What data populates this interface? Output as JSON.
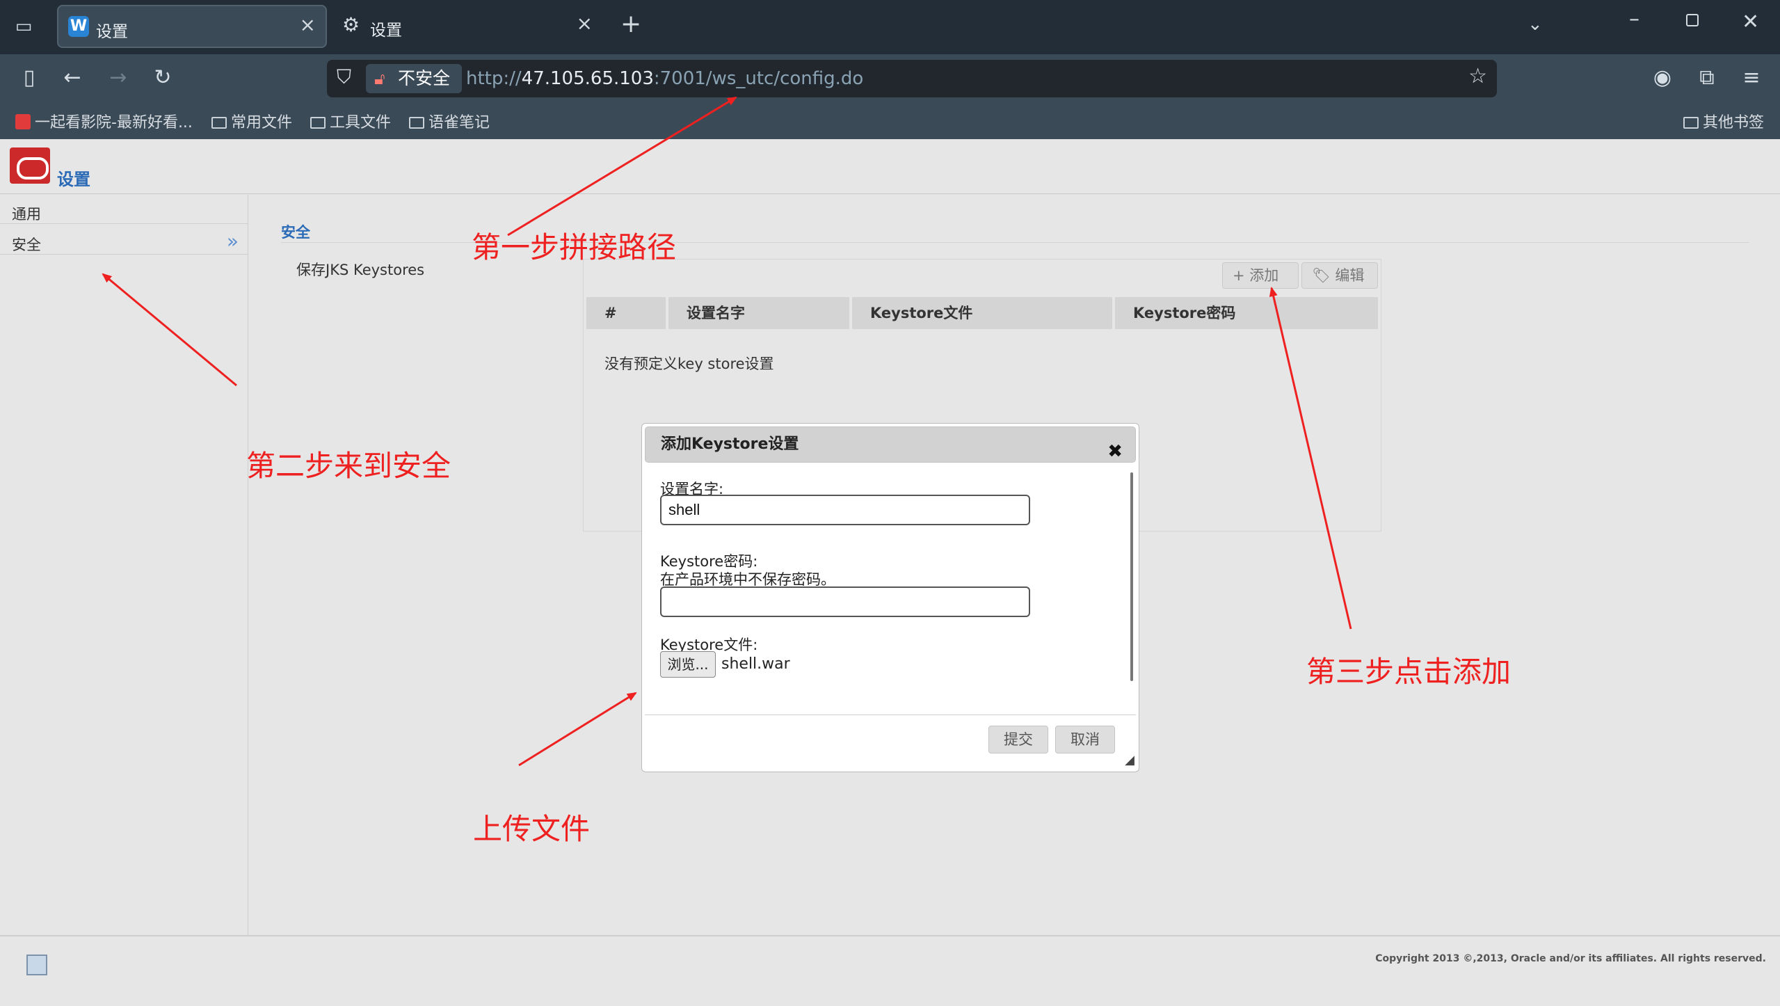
{
  "browser": {
    "tabs": [
      {
        "title": "设置",
        "close": "×"
      },
      {
        "title": "设置",
        "close": "×"
      }
    ],
    "new_tab": "+",
    "insecure_label": "不安全",
    "url_prefix": "http://",
    "url_host": "47.105.65.103",
    "url_rest": ":7001/ws_utc/config.do",
    "bookmarks": [
      "一起看影院-最新好看...",
      "常用文件",
      "工具文件",
      "语雀笔记"
    ],
    "other_bookmarks": "其他书签"
  },
  "header": {
    "title": "设置"
  },
  "sidebar": {
    "items": [
      {
        "label": "通用"
      },
      {
        "label": "安全",
        "arrow": "»"
      }
    ]
  },
  "main": {
    "section_title": "安全",
    "sub_label": "保存JKS Keystores",
    "toolbar": {
      "add": "添加",
      "edit": "编辑"
    },
    "table": {
      "columns": [
        "#",
        "设置名字",
        "Keystore文件",
        "Keystore密码"
      ],
      "empty_text": "没有预定义key store设置"
    }
  },
  "dialog": {
    "title": "添加Keystore设置",
    "close": "✖",
    "name_label": "设置名字:",
    "name_value": "shell",
    "password_label": "Keystore密码:",
    "password_hint": "在产品环境中不保存密码。",
    "password_value": "",
    "file_label": "Keystore文件:",
    "browse_label": "浏览...",
    "file_name": "shell.war",
    "submit": "提交",
    "cancel": "取消"
  },
  "footer": {
    "copyright": "Copyright 2013 ©,2013, Oracle and/or its affiliates. All rights reserved."
  },
  "annotations": {
    "step1": "第一步拼接路径",
    "step2": "第二步来到安全",
    "step3": "第三步点击添加",
    "upload": "上传文件"
  },
  "colors": {
    "annotation": "#ee2020",
    "accent": "#2b6ab6",
    "chrome": "#3b4a57"
  }
}
